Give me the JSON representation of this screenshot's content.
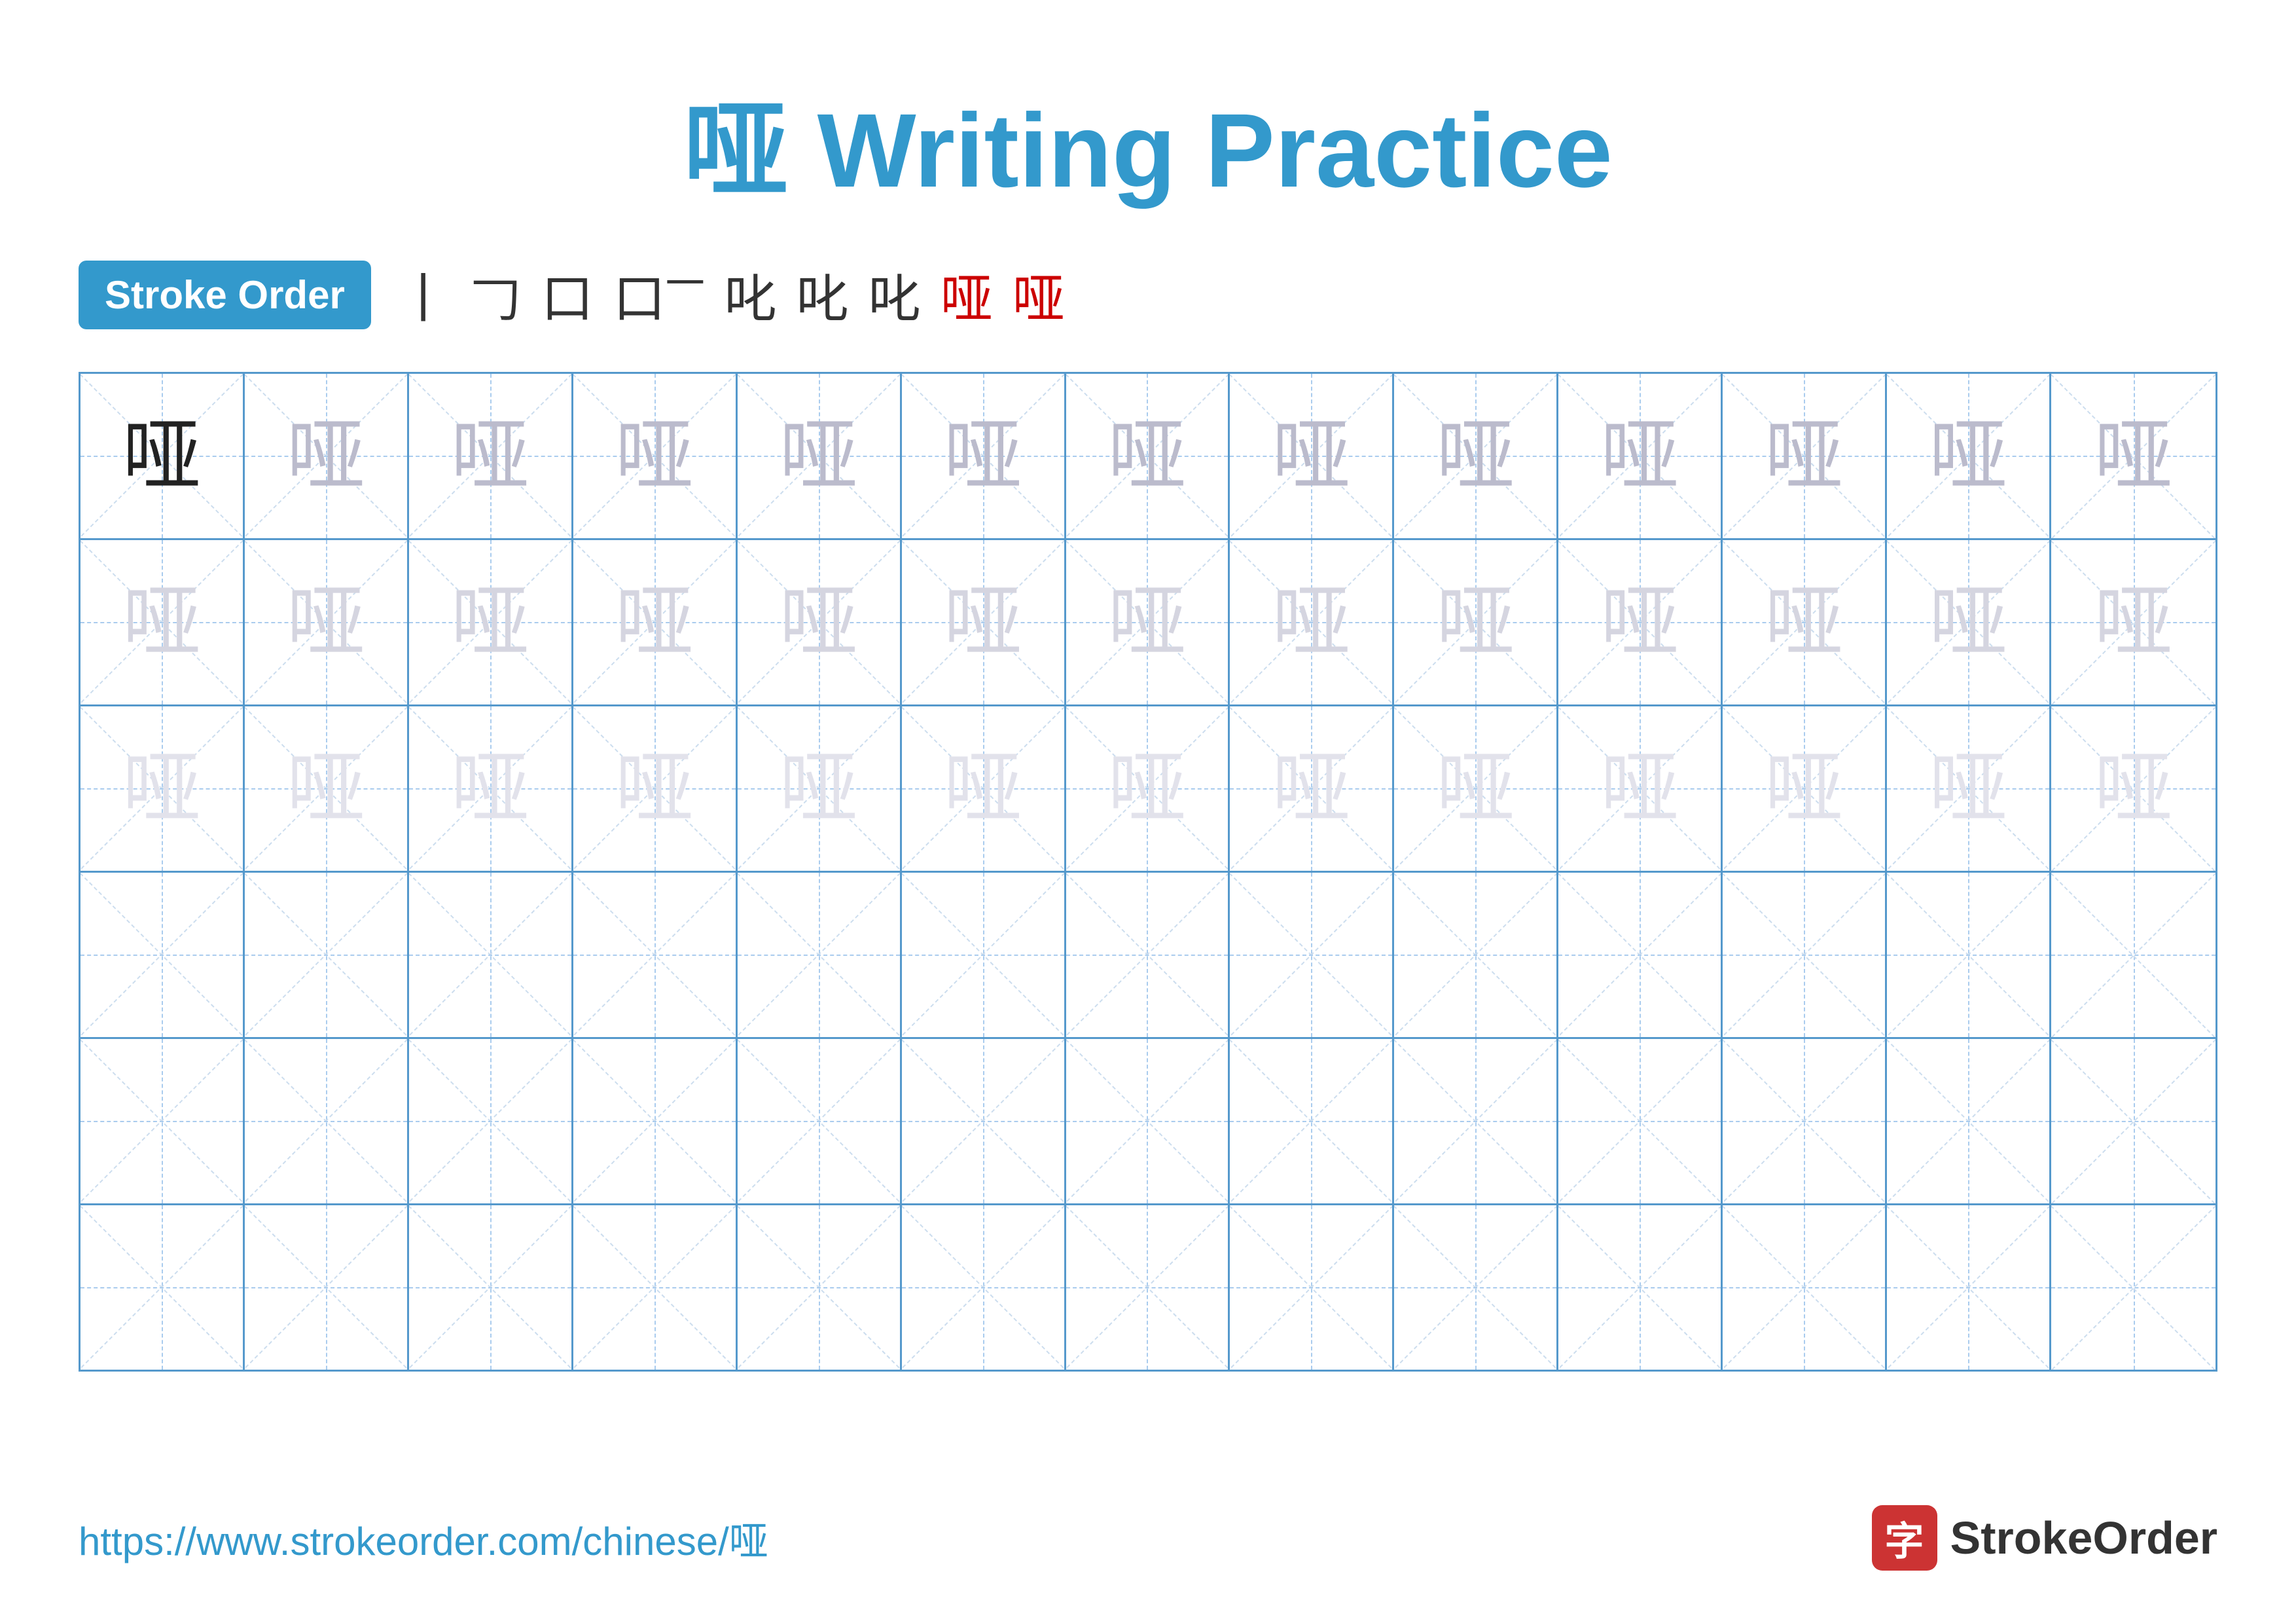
{
  "title": "哑 Writing Practice",
  "stroke_order": {
    "badge_label": "Stroke Order",
    "sequence": [
      "丨",
      "𠃌",
      "口",
      "口一",
      "叱",
      "叱",
      "叱",
      "哑",
      "哑"
    ]
  },
  "character": "哑",
  "grid": {
    "rows": 6,
    "cols": 13,
    "row_data": [
      {
        "cells": [
          {
            "char": "哑",
            "style": "dark"
          },
          {
            "char": "哑",
            "style": "medium"
          },
          {
            "char": "哑",
            "style": "medium"
          },
          {
            "char": "哑",
            "style": "medium"
          },
          {
            "char": "哑",
            "style": "medium"
          },
          {
            "char": "哑",
            "style": "medium"
          },
          {
            "char": "哑",
            "style": "medium"
          },
          {
            "char": "哑",
            "style": "medium"
          },
          {
            "char": "哑",
            "style": "medium"
          },
          {
            "char": "哑",
            "style": "medium"
          },
          {
            "char": "哑",
            "style": "medium"
          },
          {
            "char": "哑",
            "style": "medium"
          },
          {
            "char": "哑",
            "style": "medium"
          }
        ]
      },
      {
        "cells": [
          {
            "char": "哑",
            "style": "light"
          },
          {
            "char": "哑",
            "style": "light"
          },
          {
            "char": "哑",
            "style": "light"
          },
          {
            "char": "哑",
            "style": "light"
          },
          {
            "char": "哑",
            "style": "light"
          },
          {
            "char": "哑",
            "style": "light"
          },
          {
            "char": "哑",
            "style": "light"
          },
          {
            "char": "哑",
            "style": "light"
          },
          {
            "char": "哑",
            "style": "light"
          },
          {
            "char": "哑",
            "style": "light"
          },
          {
            "char": "哑",
            "style": "light"
          },
          {
            "char": "哑",
            "style": "light"
          },
          {
            "char": "哑",
            "style": "light"
          }
        ]
      },
      {
        "cells": [
          {
            "char": "哑",
            "style": "very-light"
          },
          {
            "char": "哑",
            "style": "very-light"
          },
          {
            "char": "哑",
            "style": "very-light"
          },
          {
            "char": "哑",
            "style": "very-light"
          },
          {
            "char": "哑",
            "style": "very-light"
          },
          {
            "char": "哑",
            "style": "very-light"
          },
          {
            "char": "哑",
            "style": "very-light"
          },
          {
            "char": "哑",
            "style": "very-light"
          },
          {
            "char": "哑",
            "style": "very-light"
          },
          {
            "char": "哑",
            "style": "very-light"
          },
          {
            "char": "哑",
            "style": "very-light"
          },
          {
            "char": "哑",
            "style": "very-light"
          },
          {
            "char": "哑",
            "style": "very-light"
          }
        ]
      },
      {
        "cells": [
          {
            "char": "",
            "style": "empty"
          },
          {
            "char": "",
            "style": "empty"
          },
          {
            "char": "",
            "style": "empty"
          },
          {
            "char": "",
            "style": "empty"
          },
          {
            "char": "",
            "style": "empty"
          },
          {
            "char": "",
            "style": "empty"
          },
          {
            "char": "",
            "style": "empty"
          },
          {
            "char": "",
            "style": "empty"
          },
          {
            "char": "",
            "style": "empty"
          },
          {
            "char": "",
            "style": "empty"
          },
          {
            "char": "",
            "style": "empty"
          },
          {
            "char": "",
            "style": "empty"
          },
          {
            "char": "",
            "style": "empty"
          }
        ]
      },
      {
        "cells": [
          {
            "char": "",
            "style": "empty"
          },
          {
            "char": "",
            "style": "empty"
          },
          {
            "char": "",
            "style": "empty"
          },
          {
            "char": "",
            "style": "empty"
          },
          {
            "char": "",
            "style": "empty"
          },
          {
            "char": "",
            "style": "empty"
          },
          {
            "char": "",
            "style": "empty"
          },
          {
            "char": "",
            "style": "empty"
          },
          {
            "char": "",
            "style": "empty"
          },
          {
            "char": "",
            "style": "empty"
          },
          {
            "char": "",
            "style": "empty"
          },
          {
            "char": "",
            "style": "empty"
          },
          {
            "char": "",
            "style": "empty"
          }
        ]
      },
      {
        "cells": [
          {
            "char": "",
            "style": "empty"
          },
          {
            "char": "",
            "style": "empty"
          },
          {
            "char": "",
            "style": "empty"
          },
          {
            "char": "",
            "style": "empty"
          },
          {
            "char": "",
            "style": "empty"
          },
          {
            "char": "",
            "style": "empty"
          },
          {
            "char": "",
            "style": "empty"
          },
          {
            "char": "",
            "style": "empty"
          },
          {
            "char": "",
            "style": "empty"
          },
          {
            "char": "",
            "style": "empty"
          },
          {
            "char": "",
            "style": "empty"
          },
          {
            "char": "",
            "style": "empty"
          },
          {
            "char": "",
            "style": "empty"
          }
        ]
      }
    ]
  },
  "footer": {
    "url": "https://www.strokeorder.com/chinese/哑",
    "brand_label": "StrokeOrder",
    "brand_icon_char": "字"
  }
}
